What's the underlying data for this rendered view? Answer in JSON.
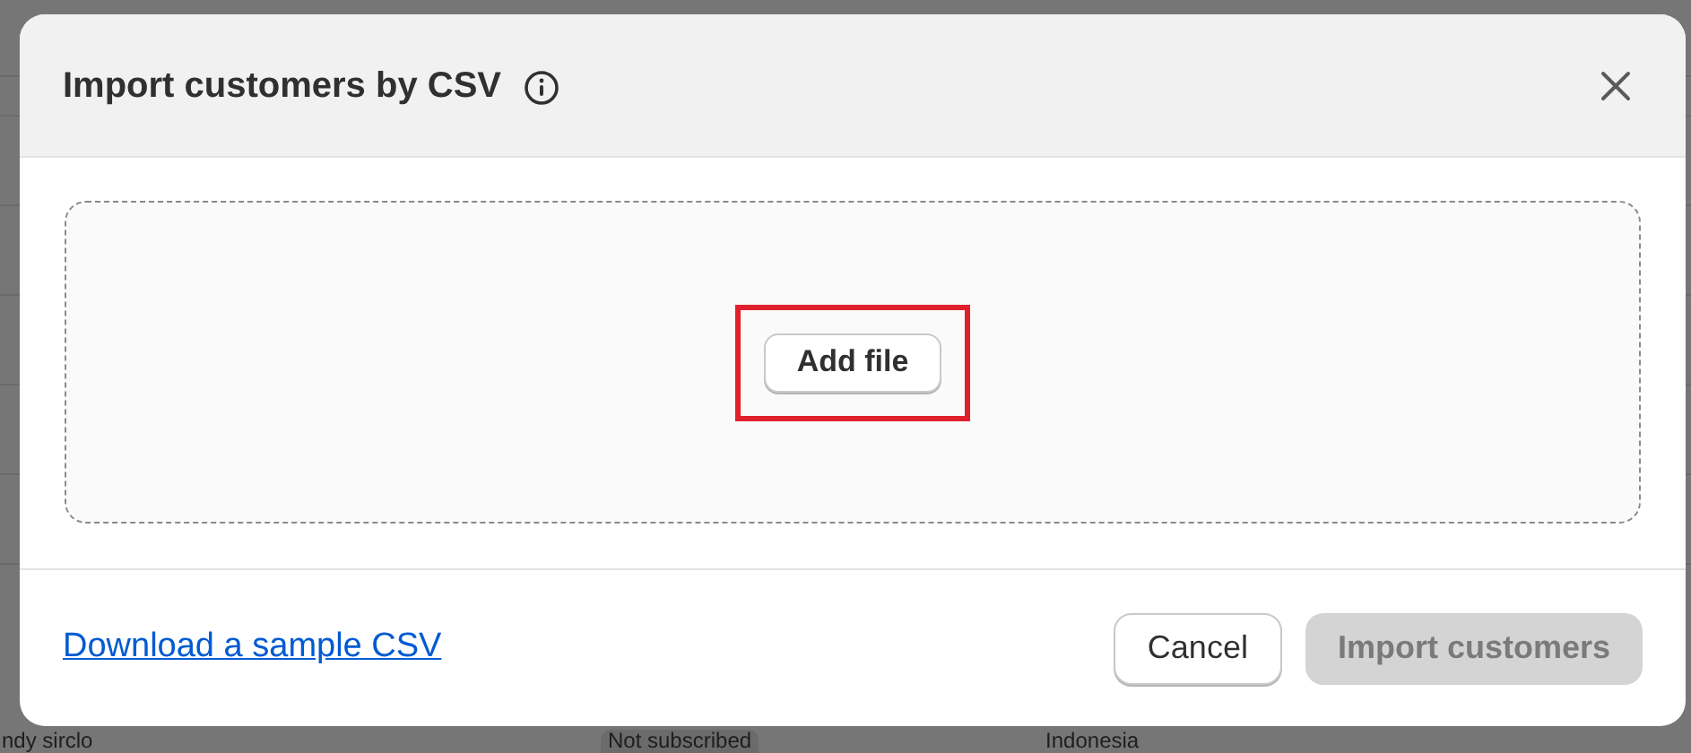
{
  "background_page": {
    "rows": [
      {
        "column_1": "ndy sirclo",
        "column_2": "Not subscribed",
        "column_3": "Indonesia"
      }
    ]
  },
  "dialog": {
    "title": "Import customers by CSV",
    "dropzone": {
      "button": "Add file",
      "highlighted": true
    },
    "footer": {
      "link": "Download a sample CSV",
      "buttons": [
        {
          "label": "Cancel",
          "kind": "secondary",
          "disabled": false
        },
        {
          "label": "Import customers",
          "kind": "primary",
          "disabled": true
        }
      ]
    }
  }
}
